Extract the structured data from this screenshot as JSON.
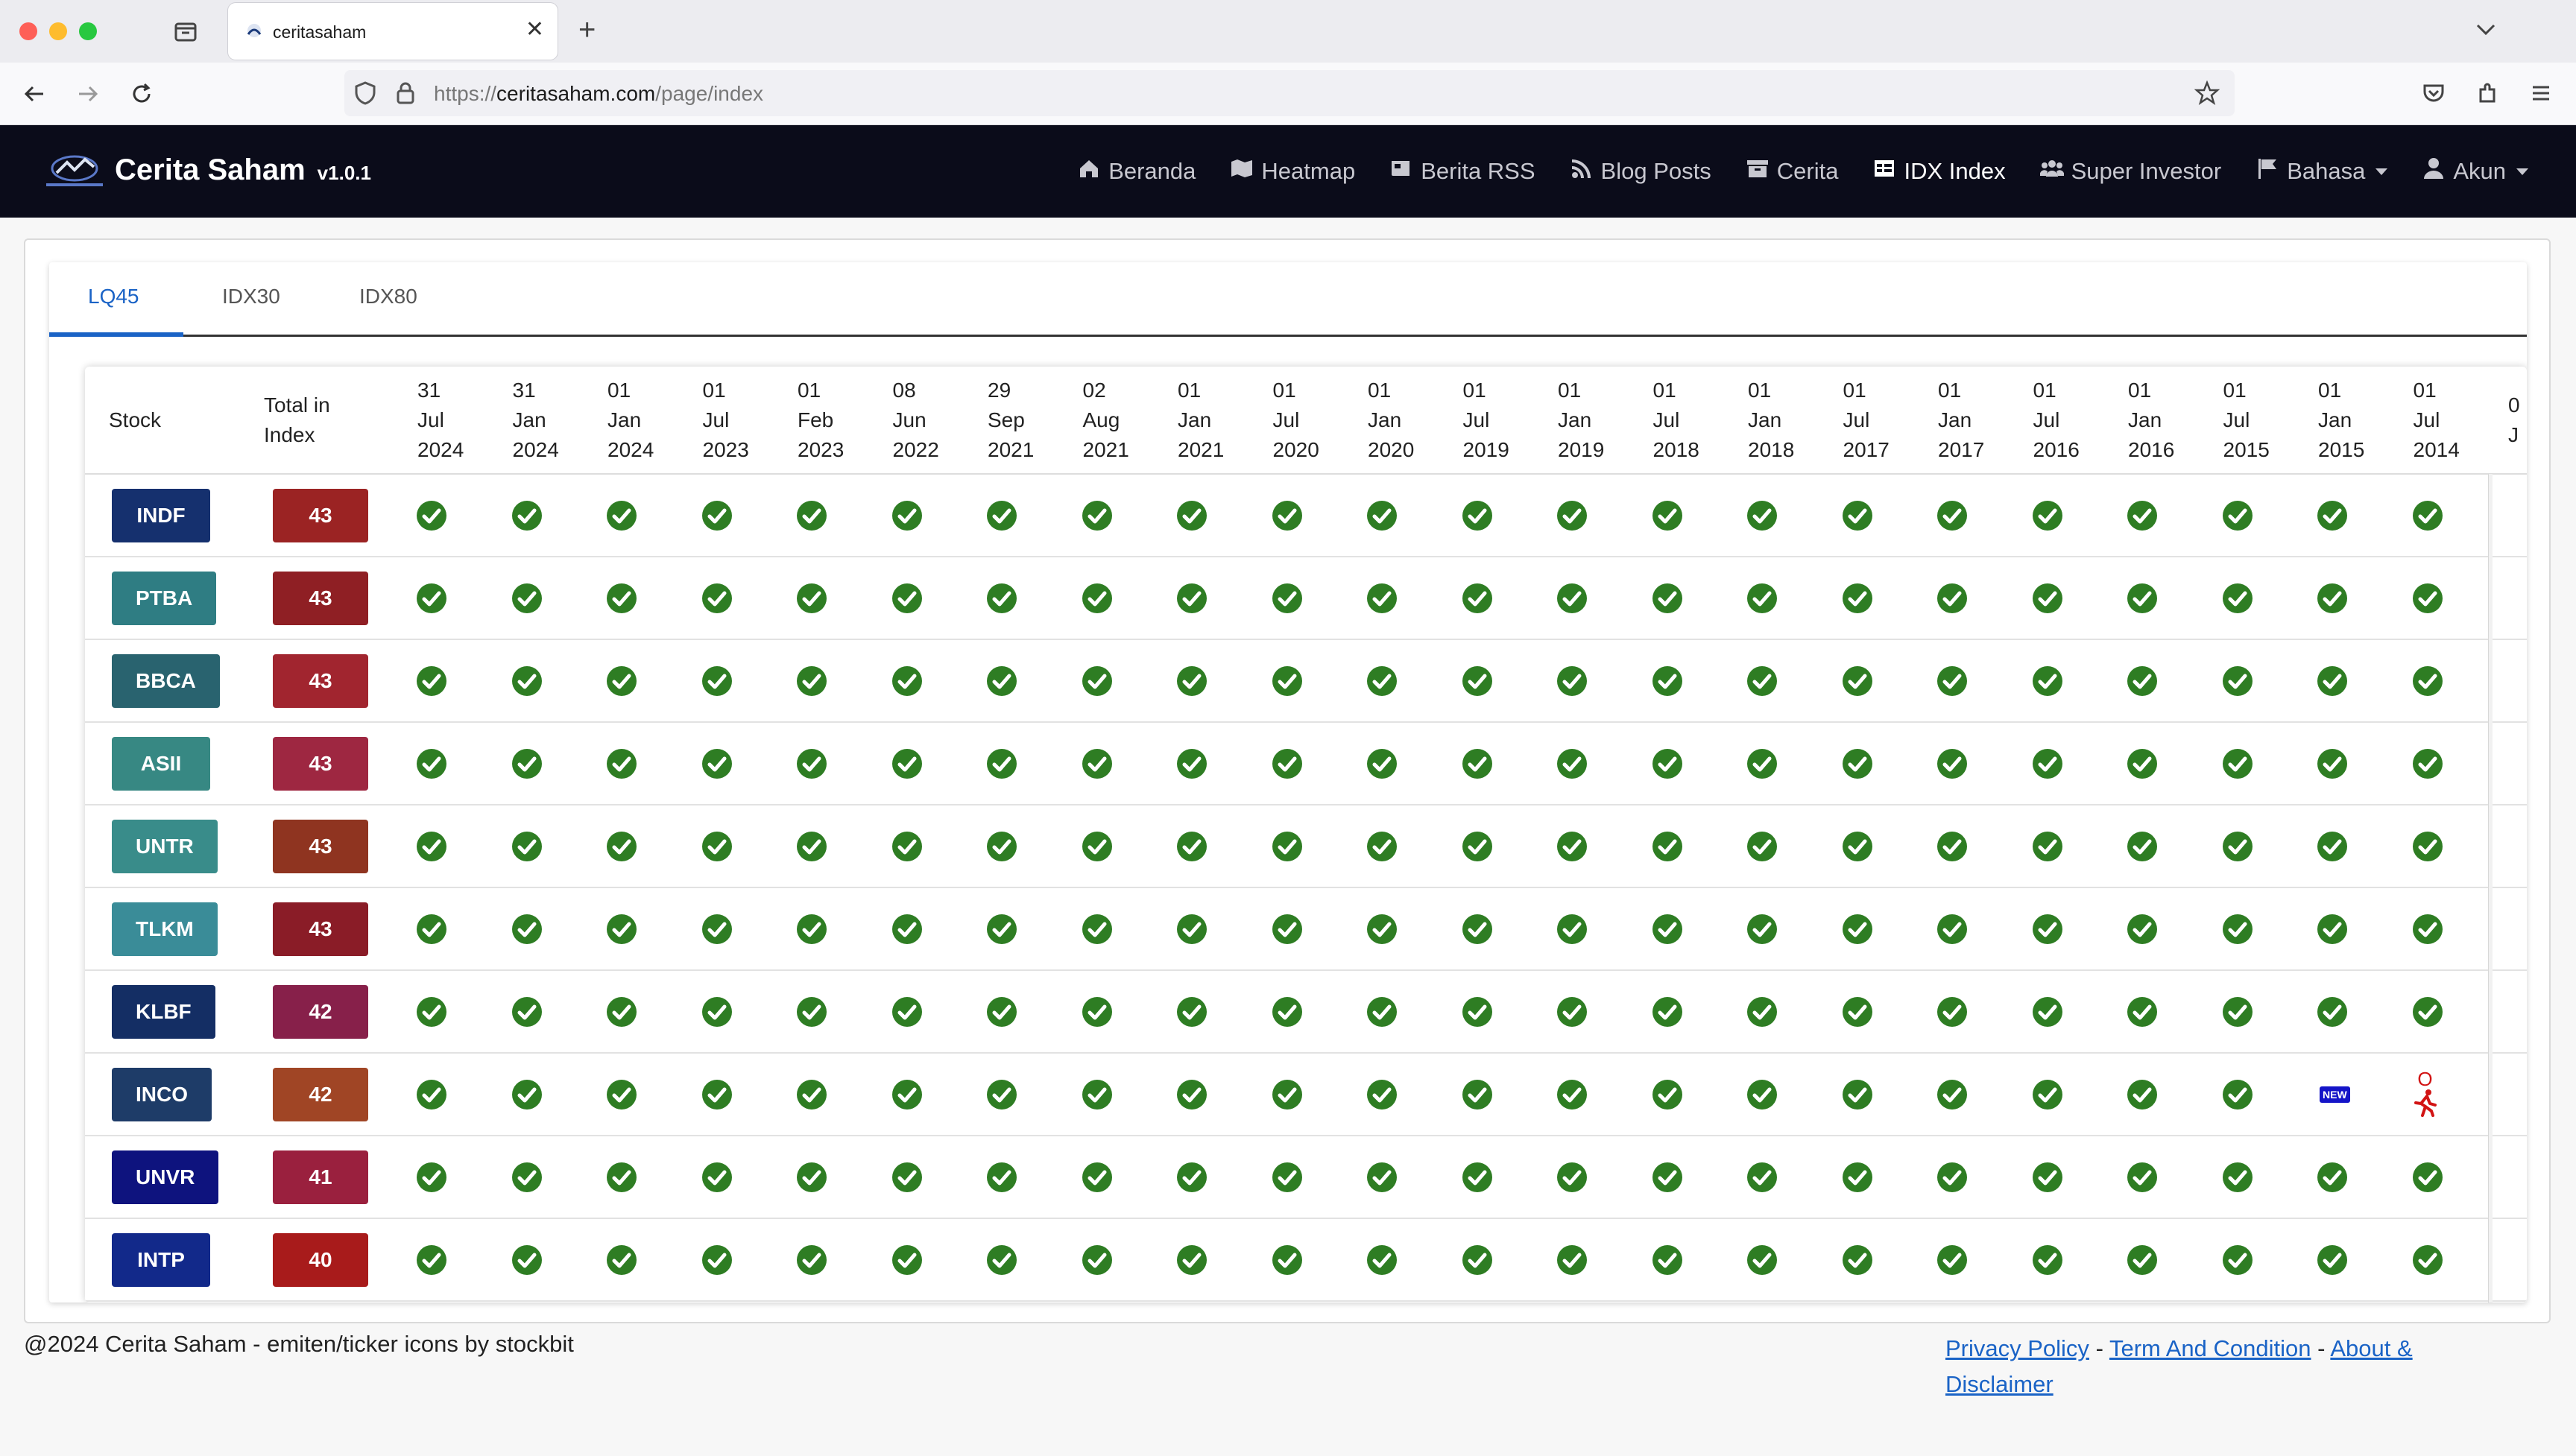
{
  "browser": {
    "tab_title": "ceritasaham",
    "url_prefix": "https://",
    "url_domain": "ceritasaham.com",
    "url_path": "/page/index",
    "new_tab_icon": "plus-icon",
    "window_controls_colors": [
      "#fe5f57",
      "#febc2e",
      "#28c840"
    ]
  },
  "site": {
    "brand": "Cerita Saham",
    "version": "v1.0.1",
    "nav": [
      {
        "label": "Beranda",
        "icon": "home-icon"
      },
      {
        "label": "Heatmap",
        "icon": "map-icon"
      },
      {
        "label": "Berita RSS",
        "icon": "newspaper-icon"
      },
      {
        "label": "Blog Posts",
        "icon": "rss-icon"
      },
      {
        "label": "Cerita",
        "icon": "archive-icon"
      },
      {
        "label": "IDX Index",
        "icon": "table-icon",
        "active": true
      },
      {
        "label": "Super Investor",
        "icon": "users-icon"
      },
      {
        "label": "Bahasa",
        "icon": "flag-icon",
        "dropdown": true
      },
      {
        "label": "Akun",
        "icon": "user-icon",
        "dropdown": true
      }
    ]
  },
  "index_tabs": [
    {
      "label": "LQ45",
      "active": true
    },
    {
      "label": "IDX30",
      "active": false
    },
    {
      "label": "IDX80",
      "active": false
    }
  ],
  "table": {
    "stock_header": "Stock",
    "total_header": "Total in Index",
    "date_columns": [
      [
        "31",
        "Jul",
        "2024"
      ],
      [
        "31",
        "Jan",
        "2024"
      ],
      [
        "01",
        "Jan",
        "2024"
      ],
      [
        "01",
        "Jul",
        "2023"
      ],
      [
        "01",
        "Feb",
        "2023"
      ],
      [
        "08",
        "Jun",
        "2022"
      ],
      [
        "29",
        "Sep",
        "2021"
      ],
      [
        "02",
        "Aug",
        "2021"
      ],
      [
        "01",
        "Jan",
        "2021"
      ],
      [
        "01",
        "Jul",
        "2020"
      ],
      [
        "01",
        "Jan",
        "2020"
      ],
      [
        "01",
        "Jul",
        "2019"
      ],
      [
        "01",
        "Jan",
        "2019"
      ],
      [
        "01",
        "Jul",
        "2018"
      ],
      [
        "01",
        "Jan",
        "2018"
      ],
      [
        "01",
        "Jul",
        "2017"
      ],
      [
        "01",
        "Jan",
        "2017"
      ],
      [
        "01",
        "Jul",
        "2016"
      ],
      [
        "01",
        "Jan",
        "2016"
      ],
      [
        "01",
        "Jul",
        "2015"
      ],
      [
        "01",
        "Jan",
        "2015"
      ],
      [
        "01",
        "Jul",
        "2014"
      ],
      [
        "0",
        "J",
        ""
      ]
    ],
    "rows": [
      {
        "stock": "INDF",
        "total": "43",
        "stock_color": "#15306e",
        "total_color": "#9b2323",
        "special": {}
      },
      {
        "stock": "PTBA",
        "total": "43",
        "stock_color": "#2f7d83",
        "total_color": "#8f1f24",
        "special": {}
      },
      {
        "stock": "BBCA",
        "total": "43",
        "stock_color": "#29636f",
        "total_color": "#a1252f",
        "special": {}
      },
      {
        "stock": "ASII",
        "total": "43",
        "stock_color": "#378883",
        "total_color": "#9e2741",
        "special": {}
      },
      {
        "stock": "UNTR",
        "total": "43",
        "stock_color": "#398c8a",
        "total_color": "#8f3420",
        "special": {}
      },
      {
        "stock": "TLKM",
        "total": "43",
        "stock_color": "#3a8c98",
        "total_color": "#8a1c27",
        "special": {}
      },
      {
        "stock": "KLBF",
        "total": "42",
        "stock_color": "#142e64",
        "total_color": "#87204a",
        "special": {}
      },
      {
        "stock": "INCO",
        "total": "42",
        "stock_color": "#1e3c68",
        "total_color": "#a04525",
        "special": {
          "20": "new",
          "21": "out"
        }
      },
      {
        "stock": "UNVR",
        "total": "41",
        "stock_color": "#0e137e",
        "total_color": "#9a203e",
        "special": {}
      },
      {
        "stock": "INTP",
        "total": "40",
        "stock_color": "#12298a",
        "total_color": "#a81b1b",
        "special": {}
      }
    ],
    "marks": {
      "included_icon": "check-circle-icon",
      "included_color": "#2e7d23",
      "new_label": "NEW",
      "new_color": "#1414c8",
      "out_label": "O",
      "out_icon": "running-person-icon",
      "out_color": "#d21414"
    }
  },
  "footer": {
    "copyright": "@2024 Cerita Saham - emiten/ticker icons by stockbit",
    "links": [
      "Privacy Policy",
      "Term And Condition",
      "About & Disclaimer"
    ],
    "separator": "-"
  }
}
